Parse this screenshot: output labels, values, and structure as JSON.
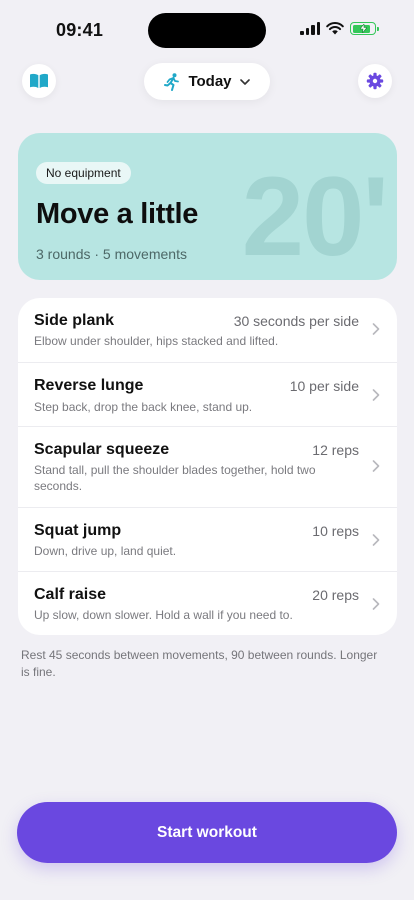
{
  "status_bar": {
    "time": "09:41",
    "battery_level": 0.74
  },
  "nav": {
    "library_icon": "book-open-icon",
    "settings_icon": "gear-icon",
    "day_selector": {
      "label": "Today",
      "icon": "running-person-icon",
      "dropdown_icon": "chevron-down-icon"
    }
  },
  "hero": {
    "badge": "No equipment",
    "title": "Move a little",
    "subtitle": "3 rounds · 5 movements",
    "duration": "20'",
    "color": "#b7e5e2"
  },
  "exercises": [
    {
      "name": "Side plank",
      "amount": "30 seconds per side",
      "description": "Elbow under shoulder, hips stacked and lifted."
    },
    {
      "name": "Reverse lunge",
      "amount": "10 per side",
      "description": "Step back, drop the back knee, stand up."
    },
    {
      "name": "Scapular squeeze",
      "amount": "12 reps",
      "description": "Stand tall, pull the shoulder blades together, hold two seconds."
    },
    {
      "name": "Squat jump",
      "amount": "10 reps",
      "description": "Down, drive up, land quiet."
    },
    {
      "name": "Calf raise",
      "amount": "20 reps",
      "description": "Up slow, down slower. Hold a wall if you need to."
    }
  ],
  "footnote": "Rest 45 seconds between movements, 90 between rounds. Longer is fine.",
  "start_button": {
    "label": "Start workout",
    "color": "#6a48e0"
  },
  "colors": {
    "accent": "#6a48e0",
    "icon_teal": "#20a8c8",
    "background": "#f1f0f5"
  }
}
